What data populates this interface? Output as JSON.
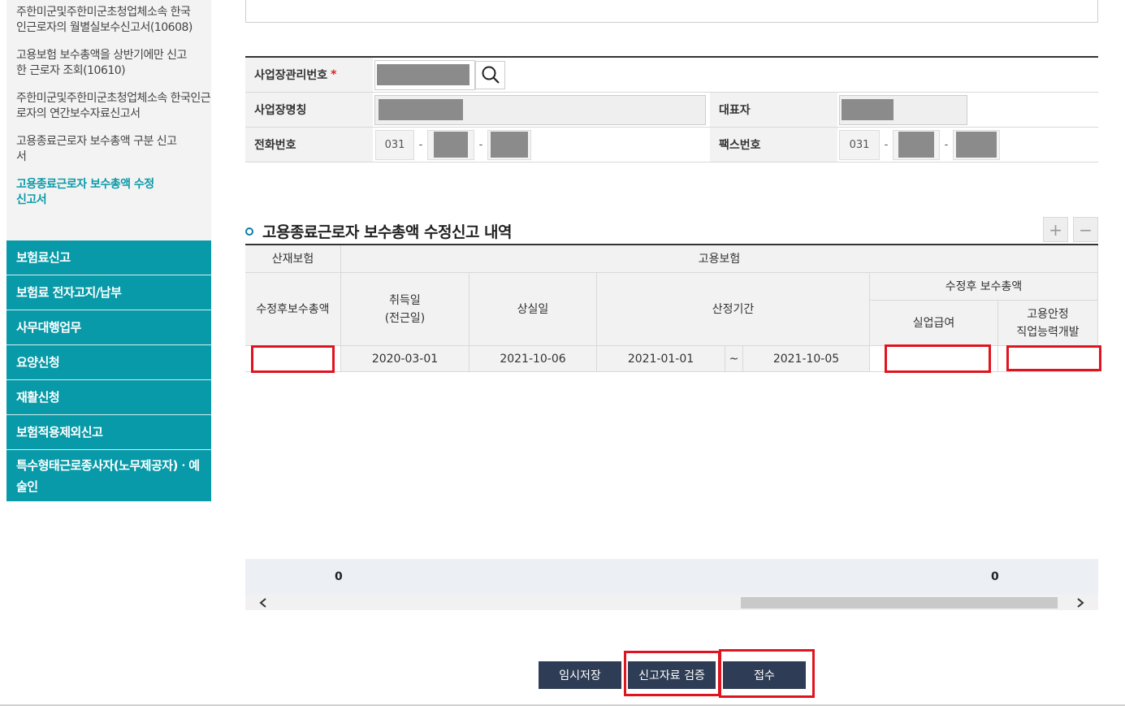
{
  "sidebar": {
    "sub_items": [
      {
        "label": "주한미군및주한미군초청업체소속 한국인근로자의 월별실보수신고서(10608)"
      },
      {
        "label": "고용보험 보수총액을 상반기에만 신고한 근로자 조회(10610)"
      },
      {
        "label": "주한미군및주한미군초청업체소속 한국인근로자의 연간보수자료신고서"
      },
      {
        "label": "고용종료근로자 보수총액 구분 신고서"
      },
      {
        "label": "고용종료근로자 보수총액 수정신고서"
      }
    ],
    "main_items": [
      {
        "label": "보험료신고"
      },
      {
        "label": "보험료 전자고지/납부"
      },
      {
        "label": "사무대행업무"
      },
      {
        "label": "요양신청"
      },
      {
        "label": "재활신청"
      },
      {
        "label": "보험적용제외신고"
      },
      {
        "label": "특수형태근로종사자(노무제공자)ㆍ예술인"
      }
    ]
  },
  "info_form": {
    "biz_mgmt_no_label": "사업장관리번호",
    "required_mark": "*",
    "biz_name_label": "사업장명칭",
    "rep_label": "대표자",
    "phone_label": "전화번호",
    "phone_area": "031",
    "fax_label": "팩스번호",
    "fax_area": "031",
    "dash": "-"
  },
  "section": {
    "title": "고용종료근로자 보수총액 수정신고 내역",
    "plus": "+",
    "minus": "−"
  },
  "grid": {
    "headers": {
      "sanjae": "산재보험",
      "goyong": "고용보험",
      "sanjae_amount": "수정후보수총액",
      "acquire_1": "취득일",
      "acquire_2": "(전근일)",
      "loss": "상실일",
      "period": "산정기간",
      "after_total": "수정후 보수총액",
      "unemployment": "실업급여",
      "stability_1": "고용안정",
      "stability_2": "직업능력개발"
    },
    "row": {
      "acquire_date": "2020-03-01",
      "loss_date": "2021-10-06",
      "period_start": "2021-01-01",
      "tilde": "~",
      "period_end": "2021-10-05"
    }
  },
  "summary": {
    "total_left": "0",
    "total_right": "0"
  },
  "buttons": {
    "temp_save": "임시저장",
    "verify": "신고자료 검증",
    "submit": "접수"
  },
  "colors": {
    "sidebar_accent": "#089aa8",
    "button_dark": "#2e3d55",
    "highlight_red": "#e0141e"
  }
}
